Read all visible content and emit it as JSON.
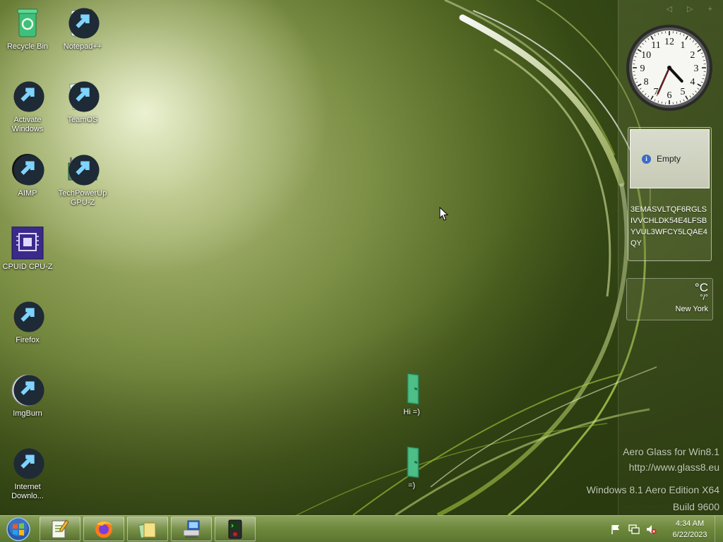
{
  "desktop": {
    "icons": [
      {
        "label": "Recycle Bin",
        "icon": "recycle-bin-icon"
      },
      {
        "label": "Notepad++",
        "icon": "notepad-plus-plus-icon"
      },
      {
        "label": "Activate Windows",
        "icon": "key-icon"
      },
      {
        "label": "TeamOS",
        "icon": "teamos-icon"
      },
      {
        "label": "AIMP",
        "icon": "aimp-icon"
      },
      {
        "label": "TechPowerUp GPU-Z",
        "icon": "gpuz-icon"
      },
      {
        "label": "CPUID CPU-Z",
        "icon": "cpuz-icon"
      },
      {
        "label": "Firefox",
        "icon": "firefox-icon"
      },
      {
        "label": "ImgBurn",
        "icon": "imgburn-icon"
      },
      {
        "label": "Internet Downlo...",
        "icon": "internet-download-manager-icon"
      },
      {
        "label": "Hi =)",
        "icon": "folder-icon"
      },
      {
        "label": "=)",
        "icon": "folder-icon"
      }
    ]
  },
  "gadgets": {
    "clock": {
      "hour": 4,
      "minute": 34,
      "second": 34
    },
    "note": {
      "title": "Empty",
      "text": "3EMASVLTQF6RGLSIVVCHLDK54E4LFSBYVUL3WFCY5LQAE4QY"
    },
    "weather": {
      "temp_unit": "°C",
      "range": "°/°",
      "city": "New York"
    },
    "sidebar_controls": "◁ ▷ +"
  },
  "watermark": {
    "line1": "Aero Glass for Win8.1",
    "line2": "http://www.glass8.eu",
    "line3": "Windows 8.1 Aero Edition X64",
    "line4": "Build 9600"
  },
  "taskbar": {
    "items": [
      {
        "icon": "notepad-plus-plus-icon"
      },
      {
        "icon": "firefox-icon"
      },
      {
        "icon": "windows-explorer-icon"
      },
      {
        "icon": "network-computer-icon"
      },
      {
        "icon": "terminal-icon"
      }
    ],
    "tray": {
      "time": "4:34 AM",
      "date": "6/22/2023"
    }
  },
  "colors": {
    "taskbar": "#6f8a3d",
    "wallpaper_dark": "#3b4f17",
    "wallpaper_light": "#e8eccf"
  }
}
